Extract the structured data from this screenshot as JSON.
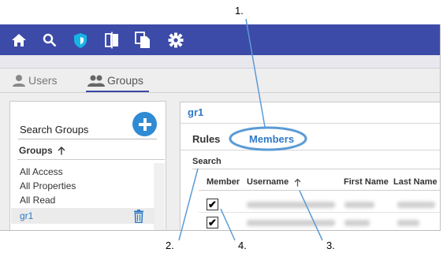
{
  "toolbar": {
    "icons": [
      "home-icon",
      "search-icon",
      "shield-icon",
      "compare-icon",
      "copy-icon",
      "gear-icon"
    ],
    "color": "#3c4aa8"
  },
  "nav_tabs": {
    "users": "Users",
    "groups": "Groups"
  },
  "left": {
    "search_label": "Search Groups",
    "groups_header": "Groups",
    "sort_icon": "arrow-up-icon",
    "items": [
      "All Access",
      "All Properties",
      "All Read",
      "gr1"
    ],
    "selected": "gr1"
  },
  "right": {
    "title": "gr1",
    "tabs": {
      "rules": "Rules",
      "members": "Members"
    },
    "active_tab": "Members",
    "search_label": "Search",
    "columns": {
      "member": "Member",
      "username": "Username",
      "first_name": "First Name",
      "last_name": "Last Name"
    },
    "rows": [
      {
        "member_checked": true
      },
      {
        "member_checked": true
      }
    ]
  },
  "annotations": {
    "n1": "1.",
    "n2": "2.",
    "n3": "3.",
    "n4": "4."
  },
  "colors": {
    "accent": "#2f7ac6",
    "highlight_ring": "#5b9bd5"
  }
}
